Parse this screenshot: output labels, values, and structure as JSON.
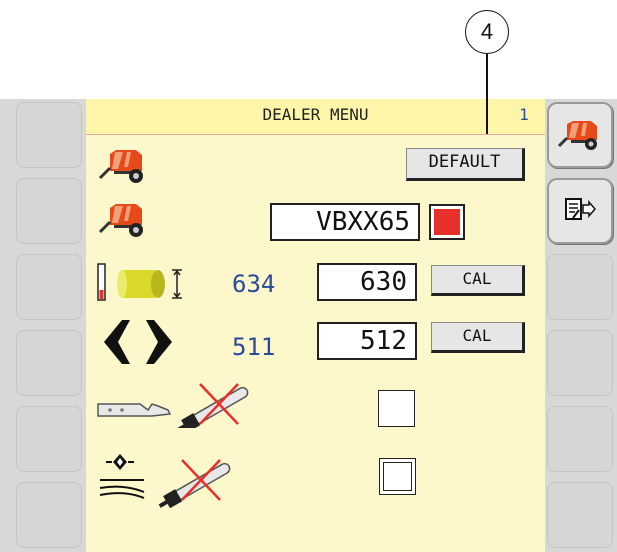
{
  "callout": {
    "number": "4"
  },
  "header": {
    "title": "DEALER MENU",
    "page": "1"
  },
  "default_button": {
    "label": "DEFAULT"
  },
  "model": {
    "value": "VBXX65",
    "indicator_color": "#e8302a"
  },
  "bale_size": {
    "reading": "634",
    "setpoint": "630",
    "cal_label": "CAL"
  },
  "bale_density": {
    "reading": "511",
    "setpoint": "512",
    "cal_label": "CAL"
  },
  "knife_option": {
    "checked": false
  },
  "pickup_option": {
    "checked": false
  },
  "icons": {
    "baler": "baler-icon",
    "bale_diameter": "bale-diameter-icon",
    "chamber_expand": "chamber-expand-icon",
    "knife_sensor": "knife-sensor-disabled-icon",
    "pickup_sensor": "pickup-sensor-disabled-icon",
    "export": "export-settings-icon"
  }
}
